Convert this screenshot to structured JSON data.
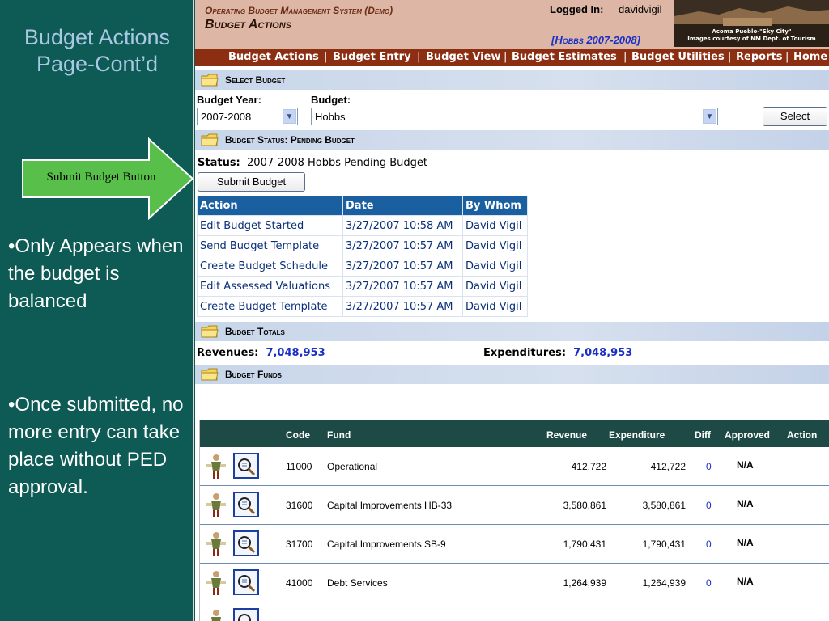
{
  "slide": {
    "title": "Budget Actions Page-Cont’d",
    "callout": "Submit Budget Button",
    "bullet1": "•Only Appears when the budget is balanced",
    "bullet2": "•Once submitted, no more entry can take place without PED approval."
  },
  "app": {
    "system_title": "Operating Budget Management System (Demo)",
    "page_heading": "Budget Actions",
    "logged_in_label": "Logged In:",
    "logged_in_user": "davidvigil",
    "context": "[Hobbs 2007-2008]",
    "photo_caption1": "Acoma Pueblo-\"Sky City\"",
    "photo_caption2": "Images courtesy of NM Dept. of Tourism",
    "nav": [
      "Budget Actions",
      "Budget Entry",
      "Budget View",
      "Budget Estimates",
      "Budget Utilities",
      "Reports",
      "Home"
    ],
    "nav_sep": "|",
    "select_budget": {
      "section_title": "Select Budget",
      "year_label": "Budget Year:",
      "year_value": "2007-2008",
      "budget_label": "Budget:",
      "budget_value": "Hobbs",
      "select_button": "Select"
    },
    "budget_status": {
      "section_title": "Budget Status: Pending Budget",
      "status_label": "Status:",
      "status_value": "2007-2008 Hobbs Pending Budget",
      "submit_button": "Submit Budget",
      "columns": [
        "Action",
        "Date",
        "By Whom"
      ],
      "rows": [
        [
          "Edit Budget Started",
          "3/27/2007 10:58 AM",
          "David Vigil"
        ],
        [
          "Send Budget Template",
          "3/27/2007 10:57 AM",
          "David Vigil"
        ],
        [
          "Create Budget Schedule",
          "3/27/2007 10:57 AM",
          "David Vigil"
        ],
        [
          "Edit Assessed Valuations",
          "3/27/2007 10:57 AM",
          "David Vigil"
        ],
        [
          "Create Budget Template",
          "3/27/2007 10:57 AM",
          "David Vigil"
        ]
      ]
    },
    "budget_totals": {
      "section_title": "Budget Totals",
      "revenues_label": "Revenues:",
      "revenues_value": "7,048,953",
      "expenditures_label": "Expenditures:",
      "expenditures_value": "7,048,953"
    },
    "budget_funds": {
      "section_title": "Budget Funds",
      "columns": [
        "Code",
        "Fund",
        "Revenue",
        "Expenditure",
        "Diff",
        "Approved",
        "Action"
      ],
      "rows": [
        {
          "code": "11000",
          "fund": "Operational",
          "revenue": "412,722",
          "expenditure": "412,722",
          "diff": "0",
          "approved": "N/A"
        },
        {
          "code": "31600",
          "fund": "Capital Improvements HB-33",
          "revenue": "3,580,861",
          "expenditure": "3,580,861",
          "diff": "0",
          "approved": "N/A"
        },
        {
          "code": "31700",
          "fund": "Capital Improvements SB-9",
          "revenue": "1,790,431",
          "expenditure": "1,790,431",
          "diff": "0",
          "approved": "N/A"
        },
        {
          "code": "41000",
          "fund": "Debt Services",
          "revenue": "1,264,939",
          "expenditure": "1,264,939",
          "diff": "0",
          "approved": "N/A"
        }
      ]
    },
    "colors": {
      "header_bg": "#ddb6a5",
      "nav_bg": "#8b2e12",
      "table_header": "#1a5fa0",
      "funds_header": "#1e4a46",
      "slide_bg": "#0e5a55"
    },
    "icons": [
      "folder-icon",
      "chevron-down-icon",
      "person-icon",
      "search-document-icon",
      "green-arrow-icon"
    ]
  }
}
